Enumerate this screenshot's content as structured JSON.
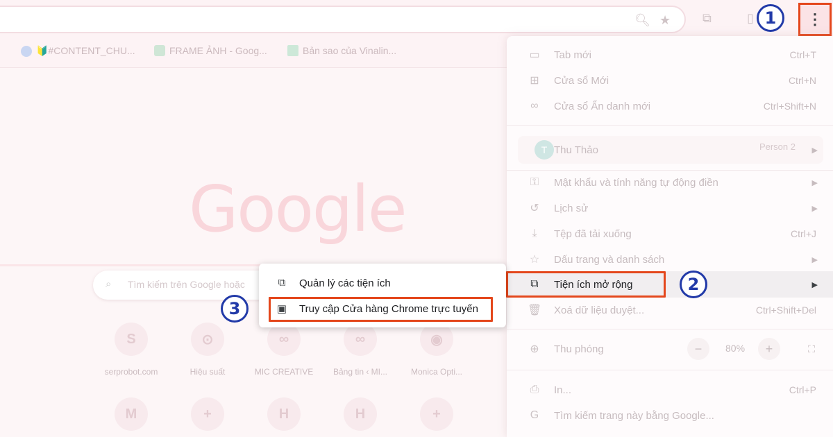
{
  "bookmarks": [
    {
      "label": "🔰#CONTENT_CHU...",
      "icon": "facebook-icon",
      "color": "#1877f2"
    },
    {
      "label": "FRAME ẢNH - Goog...",
      "icon": "drive-icon",
      "color": "#34a853"
    },
    {
      "label": "Bản sao của Vinalin...",
      "icon": "sheets-icon",
      "color": "#0f9d58"
    }
  ],
  "google_logo": "Google",
  "search_placeholder": "Tìm kiếm trên Google hoặc",
  "shortcuts_row1": [
    {
      "label": "serprobot.com",
      "glyph": "S"
    },
    {
      "label": "Hiệu suất",
      "glyph": "⊙"
    },
    {
      "label": "MIC CREATIVE",
      "glyph": "∞"
    },
    {
      "label": "Bảng tin ‹ MI...",
      "glyph": "∞"
    },
    {
      "label": "Monica Opti...",
      "glyph": "◉"
    }
  ],
  "shortcuts_row2": [
    {
      "label": "",
      "glyph": "M"
    },
    {
      "label": "",
      "glyph": "+"
    },
    {
      "label": "",
      "glyph": "H"
    },
    {
      "label": "",
      "glyph": "H"
    },
    {
      "label": "",
      "glyph": "+"
    }
  ],
  "menu": {
    "new_tab": {
      "label": "Tab mới",
      "shortcut": "Ctrl+T"
    },
    "new_window": {
      "label": "Cửa sổ Mới",
      "shortcut": "Ctrl+N"
    },
    "incognito": {
      "label": "Cửa sổ Ẩn danh mới",
      "shortcut": "Ctrl+Shift+N"
    },
    "profile": {
      "name": "Thu Thảo",
      "initial": "T",
      "badge": "Person 2"
    },
    "passwords": {
      "label": "Mật khẩu và tính năng tự động điền"
    },
    "history": {
      "label": "Lịch sử"
    },
    "downloads": {
      "label": "Tệp đã tải xuống",
      "shortcut": "Ctrl+J"
    },
    "bookmarks": {
      "label": "Dấu trang và danh sách"
    },
    "extensions": {
      "label": "Tiện ích mở rộng"
    },
    "clear_data": {
      "label": "Xoá dữ liệu duyệt...",
      "shortcut": "Ctrl+Shift+Del"
    },
    "zoom": {
      "label": "Thu phóng",
      "value": "80%",
      "minus": "−",
      "plus": "+"
    },
    "print": {
      "label": "In...",
      "shortcut": "Ctrl+P"
    },
    "search_page": {
      "label": "Tìm kiếm trang này bằng Google..."
    }
  },
  "submenu": {
    "manage": "Quản lý các tiện ích",
    "store": "Truy cập Cửa hàng Chrome trực tuyến"
  },
  "callouts": {
    "one": "1",
    "two": "2",
    "three": "3"
  },
  "colors": {
    "highlight": "#e4471c",
    "callout": "#223aa8"
  }
}
